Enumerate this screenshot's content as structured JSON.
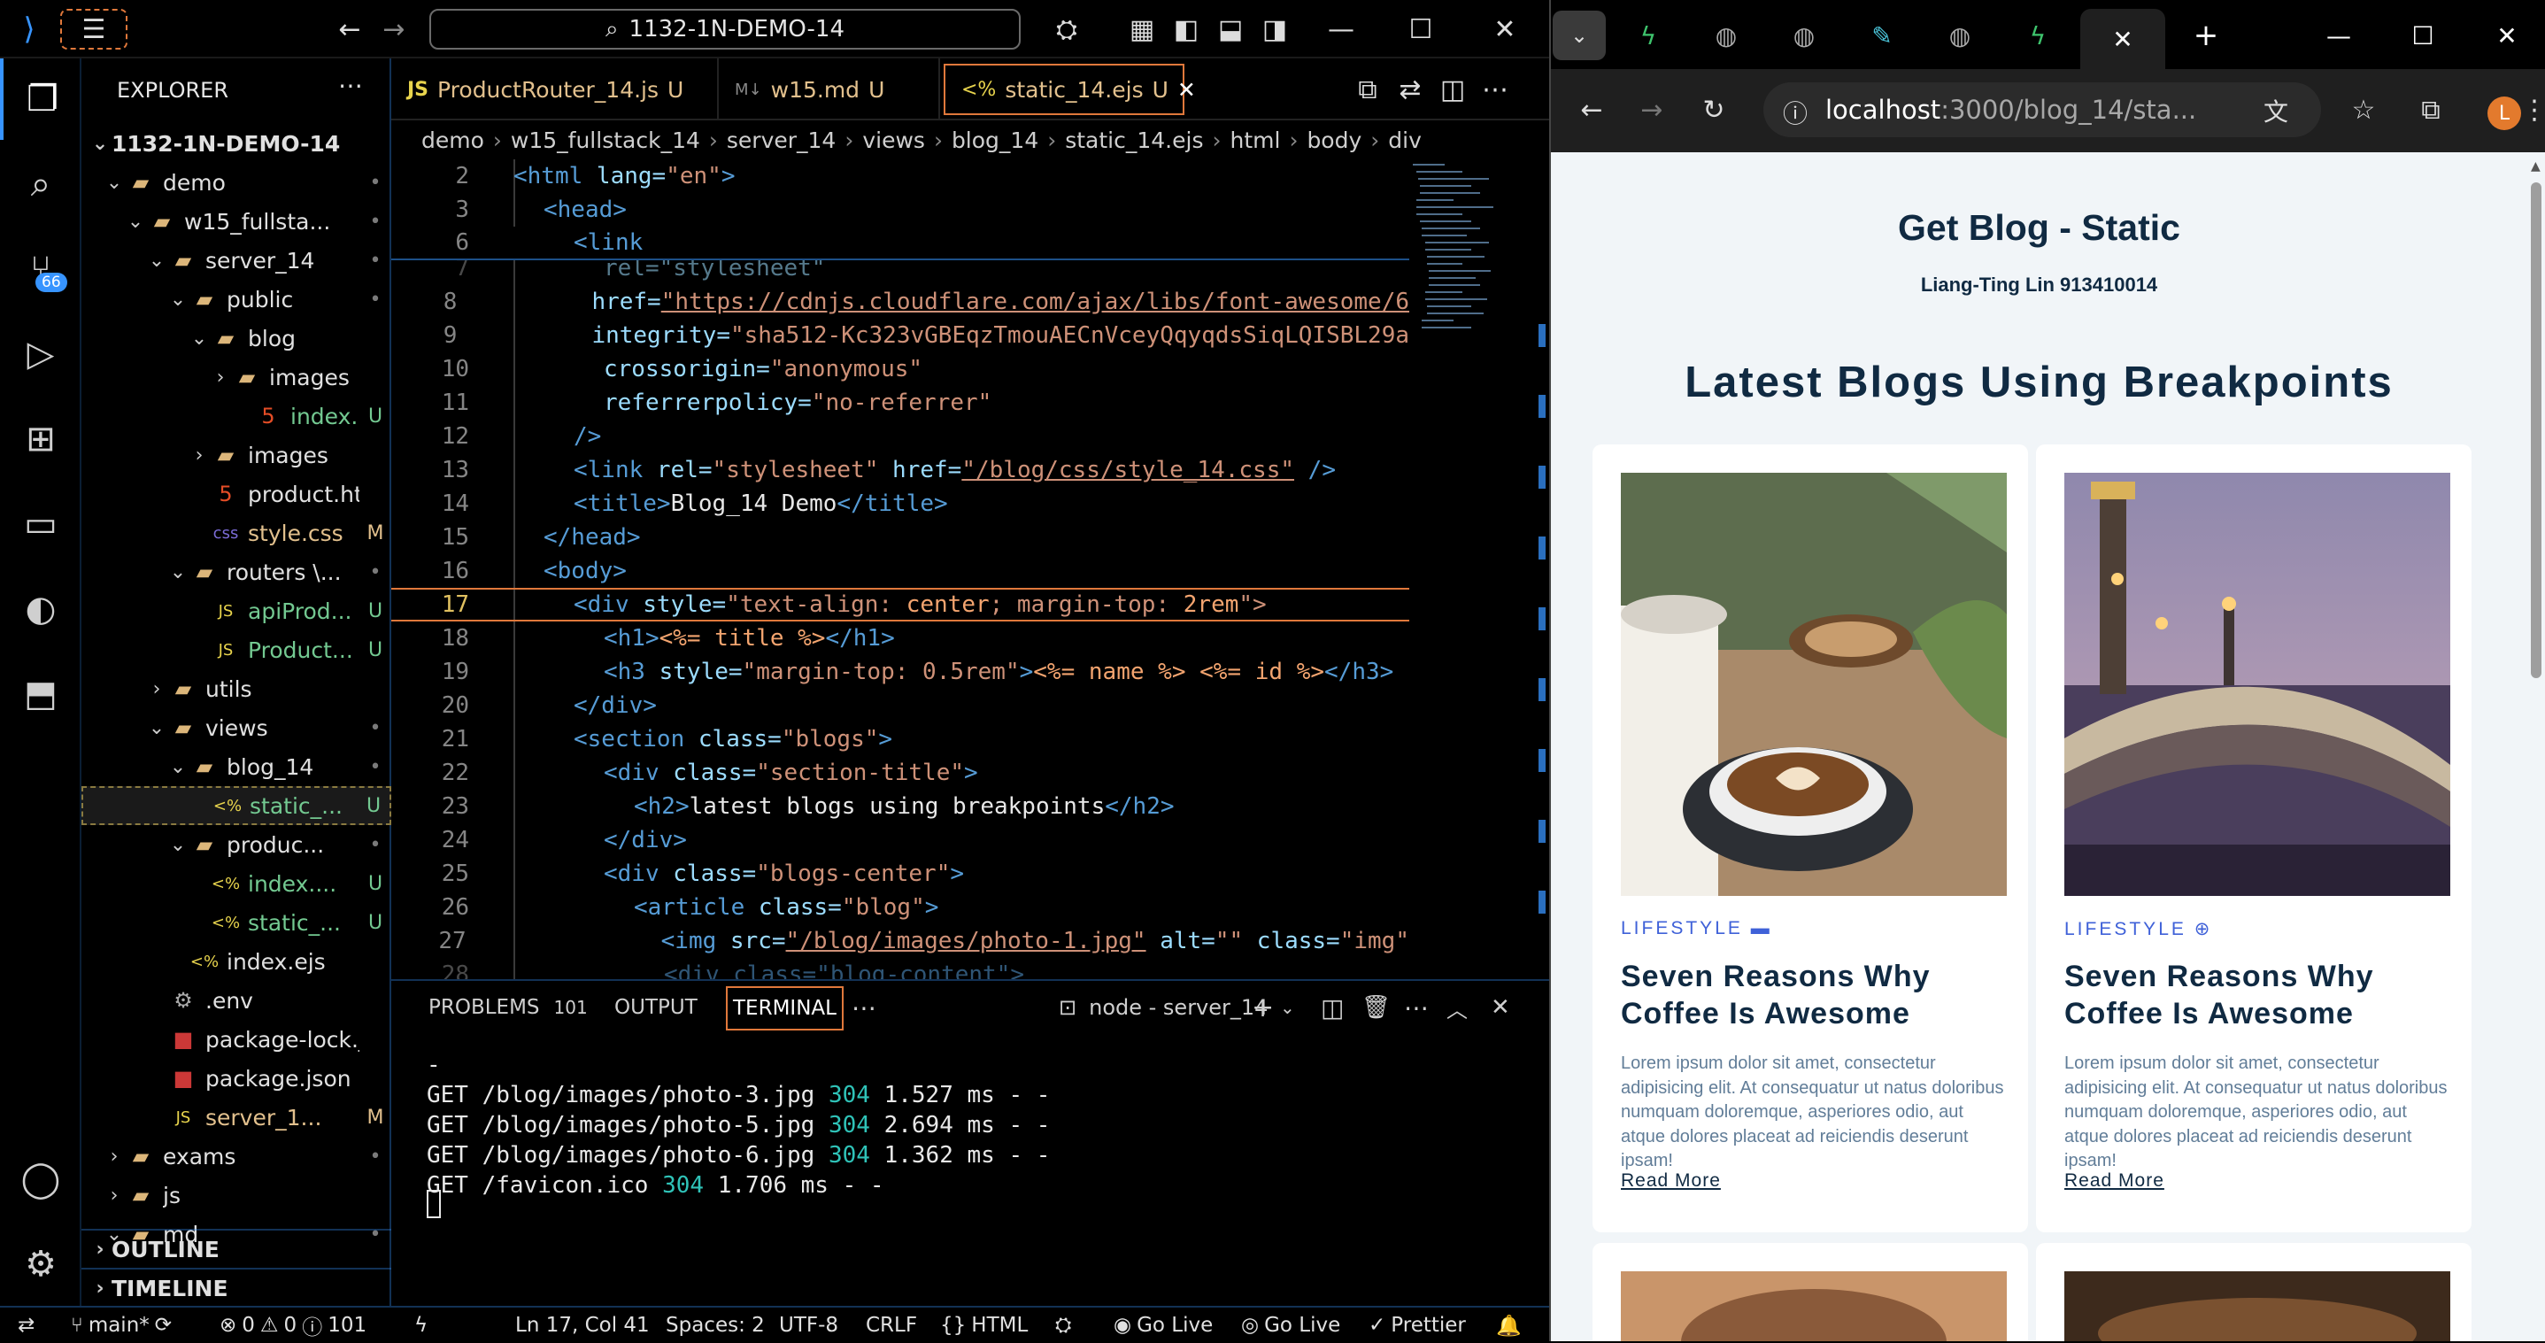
{
  "vscode": {
    "command_center": "1132-1N-DEMO-14",
    "explorer_title": "EXPLORER",
    "source_control_badge": "66",
    "workspace": "1132-1N-DEMO-14",
    "tree": [
      {
        "label": "demo",
        "type": "folder",
        "status": "•",
        "status_class": "dot"
      },
      {
        "label": "w15_fullsta...",
        "type": "folder",
        "status": "•",
        "status_class": "dot"
      },
      {
        "label": "server_14",
        "type": "folder",
        "status": "•",
        "status_class": "dot"
      },
      {
        "label": "public",
        "type": "folder",
        "status": "•",
        "status_class": "dot"
      },
      {
        "label": "blog",
        "type": "folder",
        "status": "",
        "status_class": "dot"
      },
      {
        "label": "images",
        "type": "folder",
        "status": "",
        "status_class": "dot"
      },
      {
        "label": "index....",
        "type": "html",
        "status": "U",
        "status_class": "untracked"
      },
      {
        "label": "images",
        "type": "folder",
        "status": "",
        "status_class": "dot"
      },
      {
        "label": "product.html",
        "type": "html",
        "status": "",
        "status_class": "dot"
      },
      {
        "label": "style.css",
        "type": "css",
        "status": "M",
        "status_class": "mod"
      },
      {
        "label": "routers \\...",
        "type": "folder",
        "status": "•",
        "status_class": "dot"
      },
      {
        "label": "apiProd...",
        "type": "js",
        "status": "U",
        "status_class": "untracked"
      },
      {
        "label": "Product...",
        "type": "js",
        "status": "U",
        "status_class": "untracked"
      },
      {
        "label": "utils",
        "type": "folder",
        "status": "",
        "status_class": "dot"
      },
      {
        "label": "views",
        "type": "folder",
        "status": "•",
        "status_class": "dot"
      },
      {
        "label": "blog_14",
        "type": "folder",
        "status": "•",
        "status_class": "dot"
      },
      {
        "label": "static_...",
        "type": "ejs",
        "status": "U",
        "status_class": "untracked"
      },
      {
        "label": "produc...",
        "type": "folder",
        "status": "•",
        "status_class": "dot"
      },
      {
        "label": "index....",
        "type": "ejs",
        "status": "U",
        "status_class": "untracked"
      },
      {
        "label": "static_...",
        "type": "ejs",
        "status": "U",
        "status_class": "untracked"
      },
      {
        "label": "index.ejs",
        "type": "ejs",
        "status": "",
        "status_class": "dot"
      },
      {
        "label": ".env",
        "type": "env",
        "status": "",
        "status_class": "dot"
      },
      {
        "label": "package-lock.j...",
        "type": "npm",
        "status": "",
        "status_class": "dot"
      },
      {
        "label": "package.json",
        "type": "npm",
        "status": "",
        "status_class": "dot"
      },
      {
        "label": "server_1...",
        "type": "js",
        "status": "M",
        "status_class": "mod"
      },
      {
        "label": "exams",
        "type": "folder",
        "status": "•",
        "status_class": "dot"
      },
      {
        "label": "js",
        "type": "folder",
        "status": "",
        "status_class": "dot"
      },
      {
        "label": "md",
        "type": "folder",
        "status": "•",
        "status_class": "dot"
      }
    ],
    "outline": "OUTLINE",
    "timeline": "TIMELINE",
    "tabs": [
      {
        "icon": "JS",
        "label": "ProductRouter_14.js",
        "status": "U"
      },
      {
        "icon": "M↓",
        "label": "w15.md",
        "status": "U"
      },
      {
        "icon": "<%",
        "label": "static_14.ejs",
        "status": "U"
      }
    ],
    "breadcrumb": [
      "demo",
      "w15_fullstack_14",
      "server_14",
      "views",
      "blog_14",
      "static_14.ejs",
      "html",
      "body",
      "div"
    ],
    "line_numbers": [
      "2",
      "3",
      "6",
      "7",
      "8",
      "9",
      "10",
      "11",
      "12",
      "13",
      "14",
      "15",
      "16",
      "17",
      "18",
      "19",
      "20",
      "21",
      "22",
      "23",
      "24",
      "25",
      "26",
      "27",
      "28"
    ],
    "code": {
      "l2": [
        "<html ",
        "lang=",
        "\"en\"",
        ">"
      ],
      "l3": "<head>",
      "l6": "<link",
      "l7": "rel=\"stylesheet\"",
      "l8a": "href=",
      "l8b": "\"https://cdnjs.cloudflare.com/ajax/libs/font-awesome/6",
      "l9a": "integrity=",
      "l9b": "\"sha512-Kc323vGBEqzTmouAECnVceyQqyqdsSiqLQISBL29a",
      "l10a": "crossorigin=",
      "l10b": "\"anonymous\"",
      "l11a": "referrerpolicy=",
      "l11b": "\"no-referrer\"",
      "l12": "/>",
      "l13a": "<link ",
      "l13b": "rel=",
      "l13c": "\"stylesheet\" ",
      "l13d": "href=",
      "l13e": "\"/blog/css/style_14.css\"",
      "l13f": " />",
      "l14a": "<title>",
      "l14b": "Blog_14 Demo",
      "l14c": "</title>",
      "l15": "</head>",
      "l16": "<body>",
      "l17a": "<div ",
      "l17b": "style=",
      "l17c": "\"text-align: ",
      "l17d": "center",
      "l17e": "; margin-top: ",
      "l17f": "2rem",
      "l17g": "\">",
      "l18a": "<h1>",
      "l18b": "<%= title %>",
      "l18c": "</h1>",
      "l19a": "<h3 ",
      "l19b": "style=",
      "l19c": "\"margin-top: 0.5rem\"",
      "l19d": ">",
      "l19e": "<%= name %>",
      "l19f": " ",
      "l19g": "<%= id %>",
      "l19h": "</h3>",
      "l20": "</div>",
      "l21a": "<section ",
      "l21b": "class=",
      "l21c": "\"blogs\"",
      "l21d": ">",
      "l22a": "<div ",
      "l22b": "class=",
      "l22c": "\"section-title\"",
      "l22d": ">",
      "l23a": "<h2>",
      "l23b": "latest blogs using breakpoints",
      "l23c": "</h2>",
      "l24": "</div>",
      "l25a": "<div ",
      "l25b": "class=",
      "l25c": "\"blogs-center\"",
      "l25d": ">",
      "l26a": "<article ",
      "l26b": "class=",
      "l26c": "\"blog\"",
      "l26d": ">",
      "l27a": "<img ",
      "l27b": "src=",
      "l27c": "\"/blog/images/photo-1.jpg\"",
      "l27d": " alt=",
      "l27e": "\"\"",
      "l27f": " class=",
      "l27g": "\"img\"",
      "l28": "<div class=\"blog-content\">"
    },
    "panel_tabs": {
      "problems": "PROBLEMS",
      "problems_count": "101",
      "output": "OUTPUT",
      "terminal": "TERMINAL"
    },
    "terminal_name": "node - server_14",
    "terminal_lines": [
      {
        "pre": "-",
        "num": "",
        "post": ""
      },
      {
        "pre": "GET /blog/images/photo-3.jpg ",
        "num": "304",
        "post": " 1.527 ms - -"
      },
      {
        "pre": "GET /blog/images/photo-5.jpg ",
        "num": "304",
        "post": " 2.694 ms - -"
      },
      {
        "pre": "GET /blog/images/photo-6.jpg ",
        "num": "304",
        "post": " 1.362 ms - -"
      },
      {
        "pre": "GET /favicon.ico ",
        "num": "304",
        "post": " 1.706 ms - -"
      }
    ],
    "status": {
      "branch": "main*",
      "errors": "0",
      "warnings": "0",
      "info": "101",
      "position": "Ln 17, Col 41",
      "spaces": "Spaces: 2",
      "encoding": "UTF-8",
      "eol": "CRLF",
      "language": "HTML",
      "golive1": "Go Live",
      "golive2": "Go Live",
      "prettier": "Prettier"
    }
  },
  "browser": {
    "url_host": "localhost",
    "url_rest": ":3000/blog_14/sta...",
    "profile_initial": "L",
    "page": {
      "h1": "Get Blog - Static",
      "h3": "Liang-Ting Lin 913410014",
      "section_title": "Latest Blogs Using Breakpoints",
      "cards": [
        {
          "category": "LIFESTYLE",
          "title": "Seven Reasons Why Coffee Is Awesome",
          "text": "Lorem ipsum dolor sit amet, consectetur adipisicing elit. At consequatur ut natus doloribus numquam doloremque, asperiores odio, aut atque dolores placeat ad reiciendis deserunt ipsam!",
          "link": "Read More"
        },
        {
          "category": "LIFESTYLE",
          "title": "Seven Reasons Why Coffee Is Awesome",
          "text": "Lorem ipsum dolor sit amet, consectetur adipisicing elit. At consequatur ut natus doloribus numquam doloremque, asperiores odio, aut atque dolores placeat ad reiciendis deserunt ipsam!",
          "link": "Read More"
        }
      ]
    }
  },
  "colors": {
    "accent": "#3794ff",
    "terminal_num": "#2fc3b8",
    "page_bg": "#f1f5f8",
    "heading": "#102a42"
  }
}
